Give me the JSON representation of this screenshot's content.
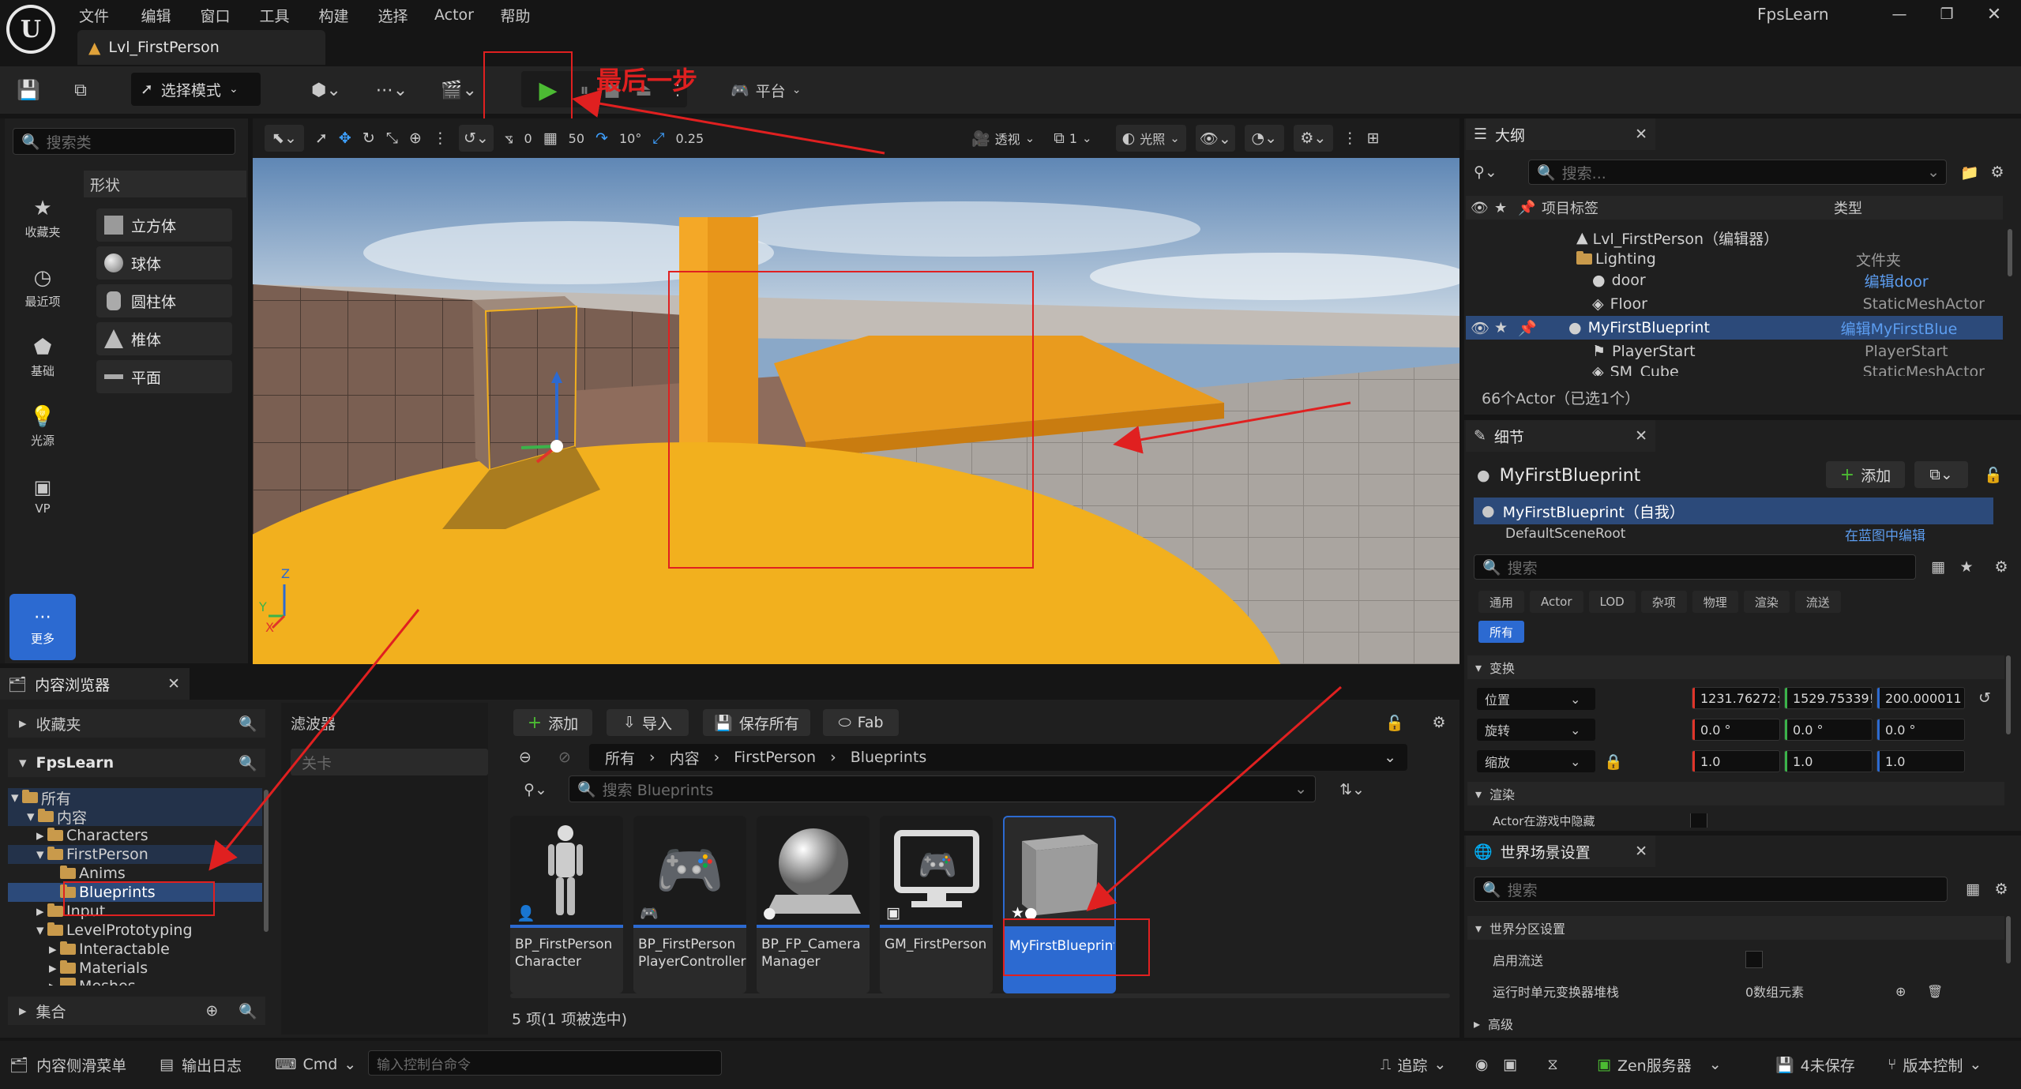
{
  "menubar": {
    "items": [
      "文件",
      "编辑",
      "窗口",
      "工具",
      "构建",
      "选择",
      "Actor",
      "帮助"
    ],
    "project": "FpsLearn"
  },
  "tab": {
    "level": "Lvl_FirstPerson"
  },
  "toolbar": {
    "mode": "选择模式",
    "annotation": "最后一步",
    "platform": "平台"
  },
  "place_panel": {
    "search_placeholder": "搜索类",
    "section": "形状",
    "side_items": [
      "收藏夹",
      "最近项",
      "基础",
      "光源",
      "VP",
      "更多"
    ],
    "shapes": [
      "立方体",
      "球体",
      "圆柱体",
      "椎体",
      "平面"
    ]
  },
  "viewport": {
    "perspective": "透视",
    "lighting": "光照",
    "grid_snap": "50",
    "rotate_snap": "10°",
    "scale_snap": "0.25",
    "angle_val": "0",
    "camera_speed": "1"
  },
  "outliner": {
    "title": "大纲",
    "search_placeholder": "搜索...",
    "col_label": "项目标签",
    "col_type": "类型",
    "rows": [
      {
        "name": "Lvl_FirstPerson（编辑器）",
        "type": ""
      },
      {
        "name": "Lighting",
        "type": "文件夹"
      },
      {
        "name": "door",
        "type": "编辑door"
      },
      {
        "name": "Floor",
        "type": "StaticMeshActor"
      },
      {
        "name": "MyFirstBlueprint",
        "type": "编辑MyFirstBlue"
      },
      {
        "name": "PlayerStart",
        "type": "PlayerStart"
      },
      {
        "name": "SM_Cube",
        "type": "StaticMeshActor"
      }
    ],
    "count": "66个Actor（已选1个）"
  },
  "details": {
    "title": "细节",
    "actor_name": "MyFirstBlueprint",
    "add": "添加",
    "self_row": "MyFirstBlueprint（自我）",
    "sub_row": "DefaultSceneRoot",
    "sub_row_type": "在蓝图中编辑",
    "search_placeholder": "搜索",
    "tabs": [
      "通用",
      "Actor",
      "LOD",
      "杂项",
      "物理",
      "渲染",
      "流送",
      "所有"
    ],
    "transform": "变换",
    "location": "位置",
    "rotation": "旋转",
    "scale": "缩放",
    "loc_vals": [
      "1231.76272:",
      "1529.75339!",
      "200.000011"
    ],
    "rot_vals": [
      "0.0 °",
      "0.0 °",
      "0.0 °"
    ],
    "scale_vals": [
      "1.0",
      "1.0",
      "1.0"
    ],
    "render": "渲染",
    "render_row": "Actor在游戏中隐藏"
  },
  "world_settings": {
    "title": "世界场景设置",
    "search_placeholder": "搜索",
    "section": "世界分区设置",
    "enable_streaming": "启用流送",
    "runtime_stack": "运行时单元变换器堆栈",
    "runtime_val": "0数组元素",
    "advanced": "高级"
  },
  "content_browser": {
    "title": "内容浏览器",
    "favorites": "收藏夹",
    "project": "FpsLearn",
    "collections": "集合",
    "filters": "滤波器",
    "filter_placeholder": "关卡",
    "add": "添加",
    "import": "导入",
    "save_all": "保存所有",
    "fab": "Fab",
    "breadcrumb": [
      "所有",
      "内容",
      "FirstPerson",
      "Blueprints"
    ],
    "search_placeholder": "搜索 Blueprints",
    "status": "5 项(1 项被选中)",
    "tree": [
      {
        "label": "所有",
        "indent": 0
      },
      {
        "label": "内容",
        "indent": 1
      },
      {
        "label": "Characters",
        "indent": 2
      },
      {
        "label": "FirstPerson",
        "indent": 2
      },
      {
        "label": "Anims",
        "indent": 3
      },
      {
        "label": "Blueprints",
        "indent": 3
      },
      {
        "label": "Input",
        "indent": 2
      },
      {
        "label": "LevelPrototyping",
        "indent": 2
      },
      {
        "label": "Interactable",
        "indent": 3
      },
      {
        "label": "Materials",
        "indent": 3
      },
      {
        "label": "Meshes",
        "indent": 3
      }
    ],
    "assets": [
      {
        "l1": "BP_FirstPerson",
        "l2": "Character"
      },
      {
        "l1": "BP_FirstPerson",
        "l2": "PlayerController"
      },
      {
        "l1": "BP_FP_Camera",
        "l2": "Manager"
      },
      {
        "l1": "GM_FirstPerson",
        "l2": ""
      },
      {
        "l1": "MyFirstBlueprint",
        "l2": ""
      }
    ]
  },
  "statusbar": {
    "drawer": "内容侧滑菜单",
    "output": "输出日志",
    "cmd": "Cmd",
    "cmd_placeholder": "输入控制台命令",
    "trace": "追踪",
    "zen": "Zen服务器",
    "unsaved": "4未保存",
    "source_control": "版本控制"
  },
  "colors": {
    "accent_blue": "#2c6ad1",
    "play_green": "#4cbb33",
    "annotation_red": "#e02020",
    "floor_yellow": "#f2b01e"
  }
}
